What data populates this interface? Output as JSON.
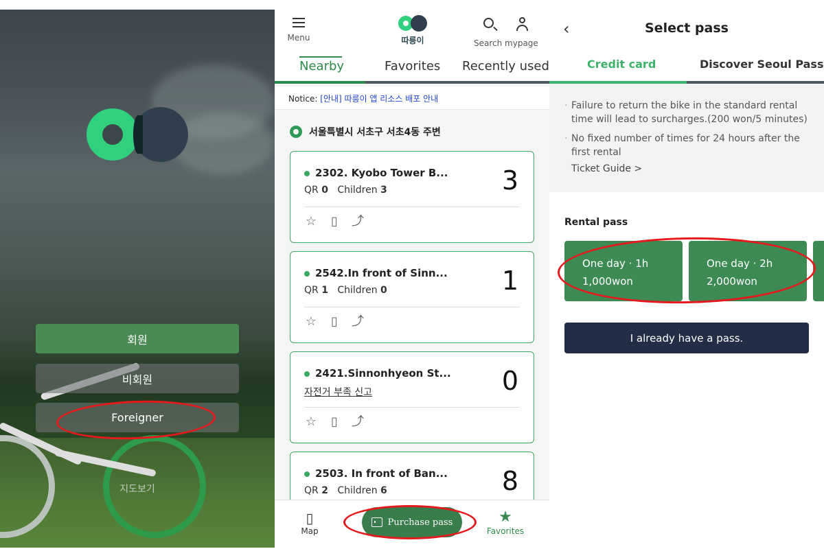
{
  "login": {
    "member_label": "회원",
    "nonmember_label": "비회원",
    "foreigner_label": "Foreigner",
    "map_label": "지도보기"
  },
  "stations": {
    "header": {
      "menu_label": "Menu",
      "app_name": "따릉이",
      "search_mypage_label": "Search mypage"
    },
    "tabs": [
      {
        "label": "Nearby",
        "active": true
      },
      {
        "label": "Favorites",
        "active": false
      },
      {
        "label": "Recently used",
        "active": false
      }
    ],
    "notice": {
      "label": "Notice:",
      "link_text": "[안내] 따릉이 앱 리소스 배포 안내"
    },
    "location": "서울특별시 서초구 서초4동 주변",
    "cards": [
      {
        "name": "2302. Kyobo Tower B...",
        "qr_label": "QR",
        "qr": "0",
        "children_label": "Children",
        "children": "3",
        "count": "3"
      },
      {
        "name": "2542.In front of Sinn...",
        "qr_label": "QR",
        "qr": "1",
        "children_label": "Children",
        "children": "0",
        "count": "1"
      },
      {
        "name": "2421.Sinnonhyeon St...",
        "report_text": "자전거 부족 신고",
        "count": "0"
      },
      {
        "name": "2503. In front of Ban...",
        "qr_label": "QR",
        "qr": "2",
        "children_label": "Children",
        "children": "6",
        "count": "8"
      }
    ],
    "bottom_nav": {
      "map_label": "Map",
      "purchase_label": "Purchase pass",
      "favorites_label": "Favorites"
    }
  },
  "select_pass": {
    "title": "Select pass",
    "tabs": [
      {
        "label": "Credit card",
        "active": true
      },
      {
        "label": "Discover Seoul Pass",
        "active": false
      }
    ],
    "info": [
      "Failure to return the bike in the standard rental time will lead to surcharges.(200 won/5 minutes)",
      "No fixed number of times for 24 hours after the first rental"
    ],
    "ticket_guide": "Ticket Guide >",
    "rental_pass_label": "Rental pass",
    "passes": [
      {
        "duration": "One day · 1h",
        "price": "1,000won"
      },
      {
        "duration": "One day · 2h",
        "price": "2,000won"
      }
    ],
    "already_have_label": "I already have a pass."
  },
  "colors": {
    "brand_green": "#2fd17f",
    "button_green": "#3e8a55",
    "dark_navy": "#222e45",
    "annotation_red": "#e5191b"
  }
}
